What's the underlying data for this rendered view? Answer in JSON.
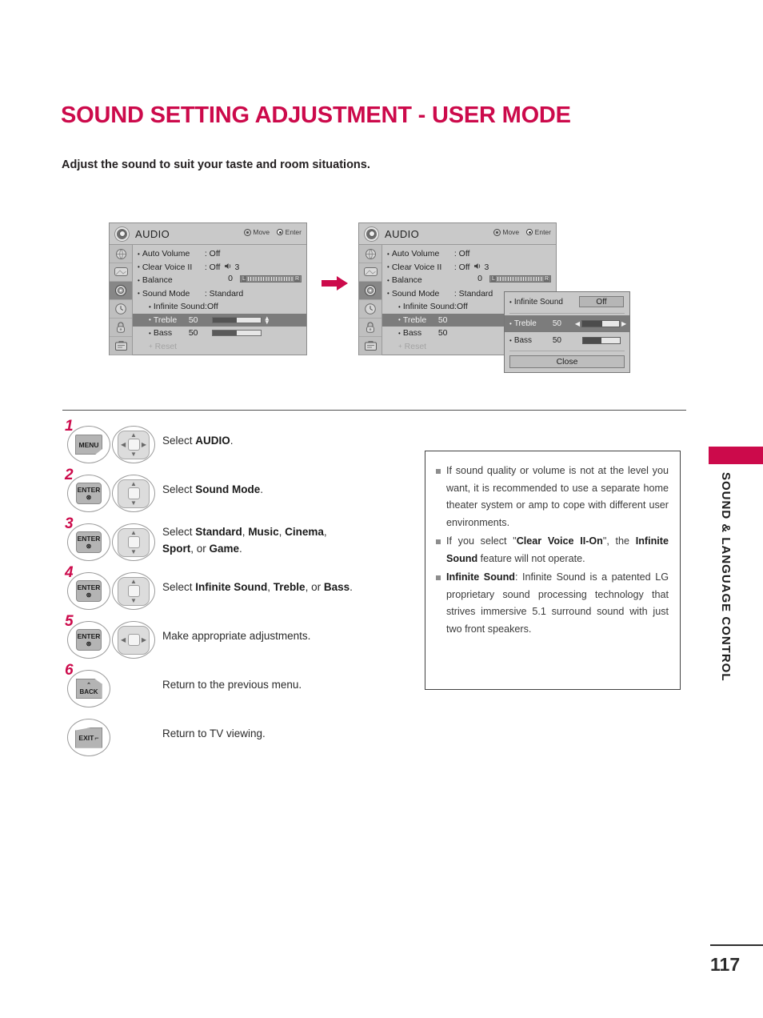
{
  "page": {
    "title": "SOUND SETTING ADJUSTMENT - USER MODE",
    "intro": "Adjust the sound to suit your taste and room situations.",
    "number": "117",
    "side_tab": "SOUND & LANGUAGE CONTROL",
    "accent_color": "#cc0a4b"
  },
  "osd": {
    "title": "AUDIO",
    "hotkeys": {
      "move": "Move",
      "enter": "Enter"
    },
    "sidebar_icons": [
      "setup-globe-icon",
      "picture-tv-icon",
      "audio-speaker-icon",
      "time-clock-icon",
      "lock-icon",
      "option-toolbox-icon"
    ],
    "rows": [
      {
        "label": "Auto Volume",
        "value": ": Off"
      },
      {
        "label": "Clear Voice II",
        "value": ": Off",
        "extra": "3"
      },
      {
        "label": "Balance",
        "value": "0",
        "bar_left": "L",
        "bar_right": "R"
      },
      {
        "label": "Sound Mode",
        "value": ": Standard"
      },
      {
        "label": "Infinite Sound:Off"
      },
      {
        "label": "Treble",
        "value": "50",
        "fill_pct": 50
      },
      {
        "label": "Bass",
        "value": "50",
        "fill_pct": 50
      },
      {
        "label": "Reset"
      }
    ]
  },
  "popup": {
    "infinite_sound_label": "Infinite Sound",
    "infinite_sound_value": "Off",
    "treble_label": "Treble",
    "treble_value": "50",
    "treble_fill_pct": 55,
    "bass_label": "Bass",
    "bass_value": "50",
    "bass_fill_pct": 50,
    "close_label": "Close"
  },
  "steps": [
    {
      "num": "1",
      "key": "MENU",
      "key_sub": "",
      "dpad": "4way",
      "text_html": "Select <b>AUDIO</b>."
    },
    {
      "num": "2",
      "key": "ENTER",
      "key_sub": "⊛",
      "dpad": "updown",
      "text_html": "Select <b>Sound Mode</b>."
    },
    {
      "num": "3",
      "key": "ENTER",
      "key_sub": "⊛",
      "dpad": "updown",
      "text_html": "Select <b>Standard</b>, <b>Music</b>, <b>Cinema</b>,<br><b>Sport</b>, or <b>Game</b>."
    },
    {
      "num": "4",
      "key": "ENTER",
      "key_sub": "⊛",
      "dpad": "updown",
      "text_html": "Select <b>Infinite Sound</b>, <b>Treble</b>, or <b>Bass</b>."
    },
    {
      "num": "5",
      "key": "ENTER",
      "key_sub": "⊛",
      "dpad": "leftright",
      "text_html": "Make appropriate adjustments."
    },
    {
      "num": "6",
      "key": "BACK",
      "key_sub": "",
      "dpad": "none",
      "text_html": "Return to the previous menu."
    },
    {
      "num": "",
      "key": "EXIT",
      "key_sub": "",
      "dpad": "none",
      "text_html": "Return to TV viewing."
    }
  ],
  "notes": [
    "If sound quality or volume is not at the level you want, it is recommended to use a separate home theater system or amp to cope with different user environments.",
    "If you select \"<b>Clear Voice II-On</b>\", the <b>Infinite Sound</b> feature will not operate.",
    "<b>Infinite Sound</b>: Infinite Sound is a patented LG proprietary sound processing technology that strives immersive 5.1 surround sound with just two front speakers."
  ]
}
